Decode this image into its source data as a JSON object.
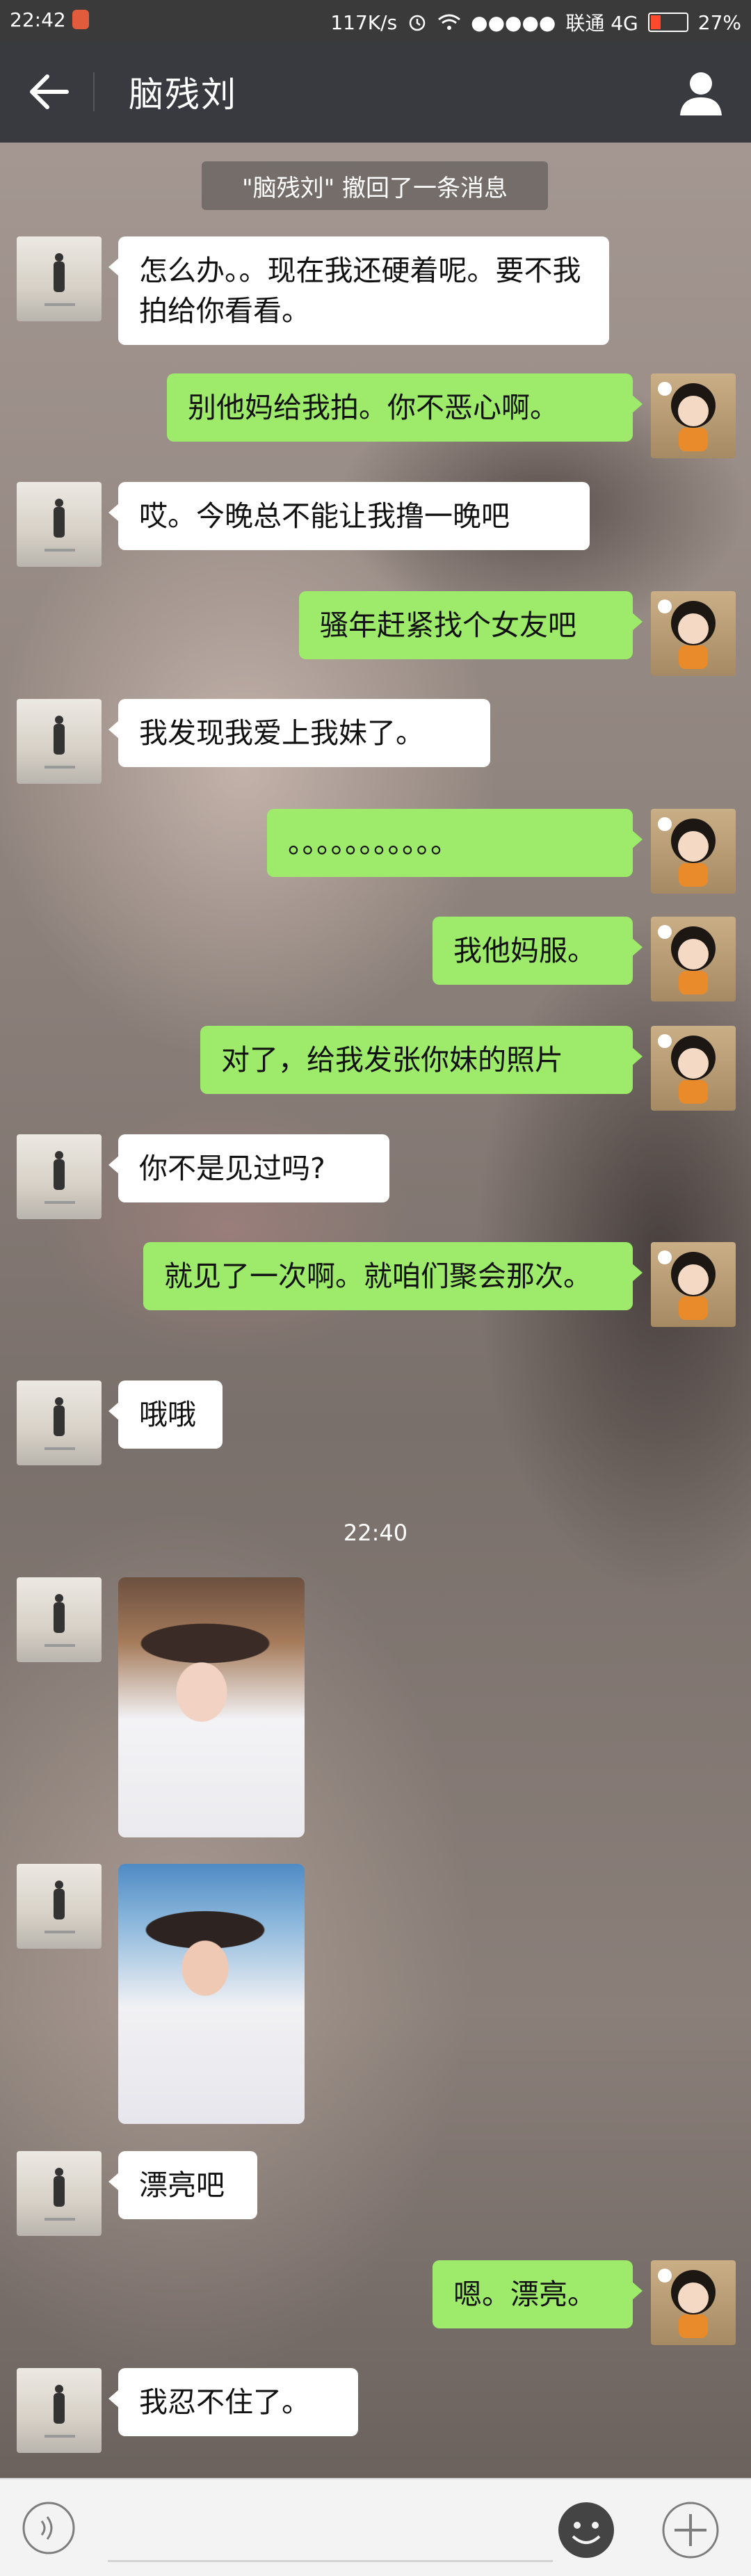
{
  "status_bar": {
    "time": "22:42",
    "net_speed": "117K/s",
    "signal": "●●●●●",
    "carrier": "联通 4G",
    "battery": "27%",
    "battery_level": 0.27
  },
  "header": {
    "title": "脑残刘"
  },
  "chat": {
    "recall_notice": "\"脑残刘\" 撤回了一条消息",
    "time_divider": "22:40",
    "messages": [
      {
        "side": "left",
        "text": "怎么办。。现在我还硬着呢。要不我拍给你看看。"
      },
      {
        "side": "right",
        "text": "别他妈给我拍。你不恶心啊。"
      },
      {
        "side": "left",
        "text": "哎。今晚总不能让我撸一晚吧"
      },
      {
        "side": "right",
        "text": "骚年赶紧找个女友吧"
      },
      {
        "side": "left",
        "text": "我发现我爱上我妹了。"
      },
      {
        "side": "right",
        "text": "。。。。。。。。。。。"
      },
      {
        "side": "right",
        "text": "我他妈服。"
      },
      {
        "side": "right",
        "text": "对了，给我发张你妹的照片"
      },
      {
        "side": "left",
        "text": "你不是见过吗?"
      },
      {
        "side": "right",
        "text": "就见了一次啊。就咱们聚会那次。"
      },
      {
        "side": "left",
        "text": "哦哦"
      },
      {
        "side": "left",
        "text": "漂亮吧"
      },
      {
        "side": "right",
        "text": "嗯。漂亮。"
      },
      {
        "side": "left",
        "text": "我忍不住了。"
      }
    ]
  },
  "colors": {
    "title_bar": "#393a3f",
    "sent_bubble": "#9eea6a",
    "received_bubble": "#ffffff"
  },
  "icons": {
    "back": "arrow-left-icon",
    "profile": "person-icon",
    "voice": "voice-icon",
    "emoji": "smiley-icon",
    "more": "plus-circle-icon"
  }
}
